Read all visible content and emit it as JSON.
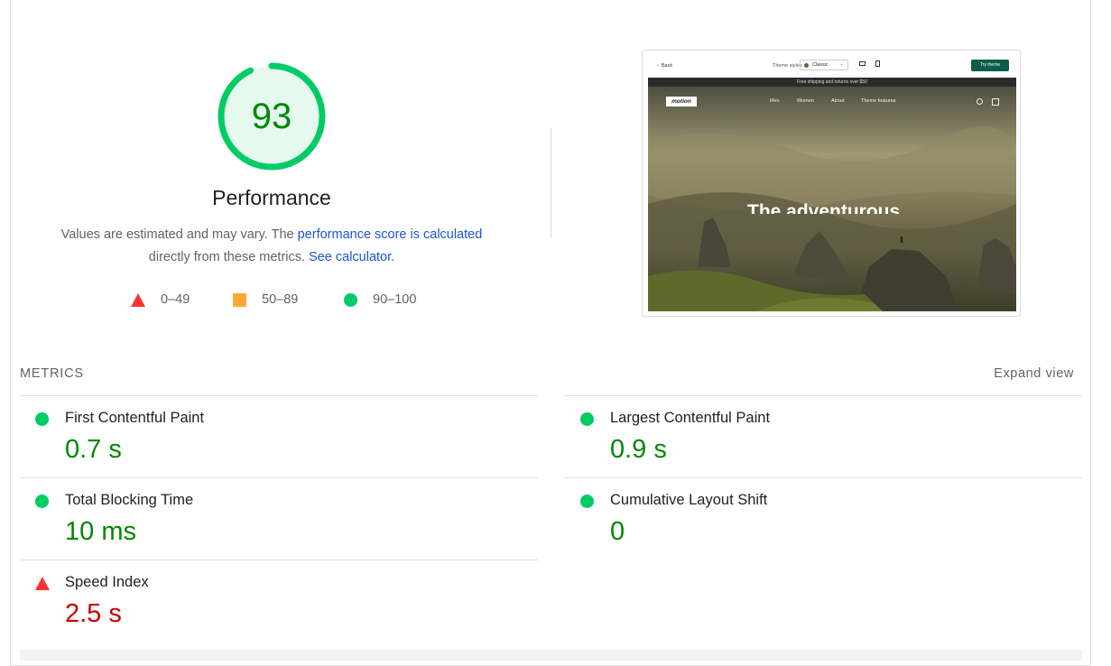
{
  "performance": {
    "score": "93",
    "score_fraction": 0.93,
    "title": "Performance",
    "description_part1": "Values are estimated and may vary. The ",
    "description_link1": "performance score is calculated",
    "description_part2": "directly from these metrics. ",
    "description_link2": "See calculator",
    "description_part3": "."
  },
  "legend": {
    "fail": "0–49",
    "average": "50–89",
    "pass": "90–100"
  },
  "preview": {
    "back": "Back",
    "theme_styles": "Theme styles",
    "style_value": "Classic",
    "try_theme": "Try theme",
    "banner": "Free shipping and returns over $50",
    "logo": "motion",
    "nav_men": "Men",
    "nav_women": "Women",
    "nav_about": "About",
    "nav_features": "Theme features",
    "headline": "The adventurous"
  },
  "metrics": {
    "label": "METRICS",
    "expand": "Expand view",
    "fcp": {
      "name": "First Contentful Paint",
      "value": "0.7 s"
    },
    "lcp": {
      "name": "Largest Contentful Paint",
      "value": "0.9 s"
    },
    "tbt": {
      "name": "Total Blocking Time",
      "value": "10 ms"
    },
    "cls": {
      "name": "Cumulative Layout Shift",
      "value": "0"
    },
    "si": {
      "name": "Speed Index",
      "value": "2.5 s"
    }
  },
  "colors": {
    "pass": "#00cc66",
    "pass_text": "#008800",
    "average": "#ffaa33",
    "fail": "#ff3333",
    "fail_text": "#cc0000",
    "link": "#1a55d6"
  },
  "icons": {
    "fail": "triangle-icon",
    "average": "square-icon",
    "pass": "circle-icon"
  }
}
